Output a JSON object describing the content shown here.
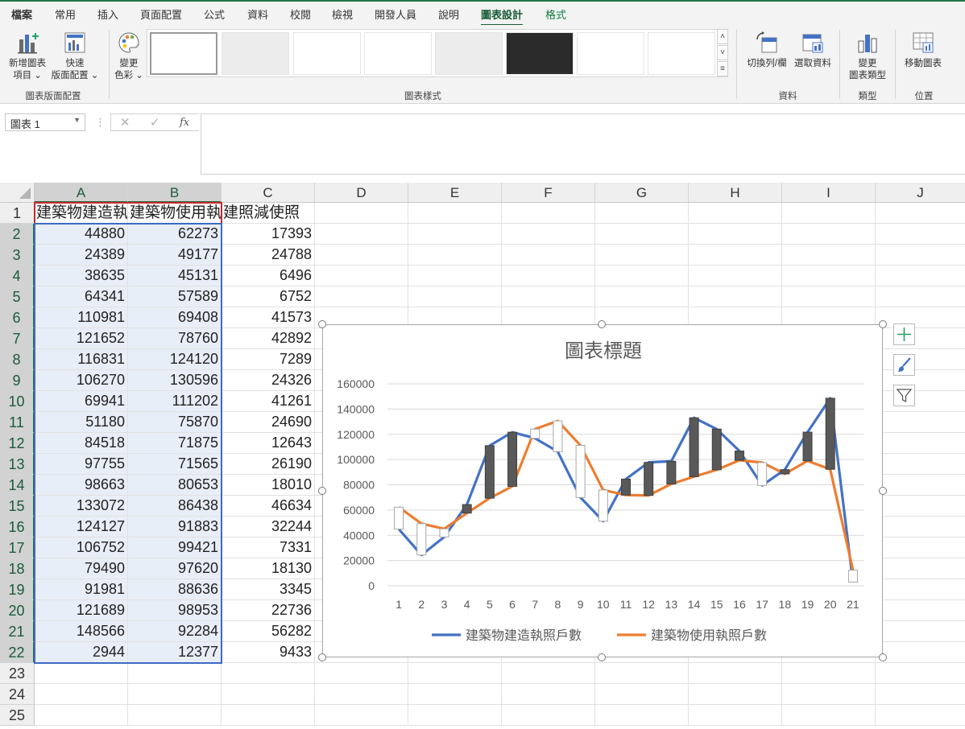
{
  "ribbon_tabs": [
    "檔案",
    "常用",
    "插入",
    "頁面配置",
    "公式",
    "資料",
    "校閱",
    "檢視",
    "開發人員",
    "說明",
    "圖表設計",
    "格式"
  ],
  "active_tab": "圖表設計",
  "ribbon": {
    "add_element": [
      "新增圖表",
      "項目"
    ],
    "quick_layout": [
      "快速",
      "版面配置"
    ],
    "change_colors": [
      "變更",
      "色彩"
    ],
    "group_layouts": "圖表版面配置",
    "group_styles": "圖表樣式",
    "switch_row_col": "切換列/欄",
    "select_data": "選取資料",
    "group_data": "資料",
    "change_type": [
      "變更",
      "圖表類型"
    ],
    "group_type": "類型",
    "move_chart": "移動圖表",
    "group_location": "位置"
  },
  "formula_bar": {
    "name_box": "圖表 1",
    "formula": ""
  },
  "columns": [
    "A",
    "B",
    "C",
    "D",
    "E",
    "F",
    "G",
    "H",
    "I",
    "J"
  ],
  "rows": [
    "1",
    "2",
    "3",
    "4",
    "5",
    "6",
    "7",
    "8",
    "9",
    "10",
    "11",
    "12",
    "13",
    "14",
    "15",
    "16",
    "17",
    "18",
    "19",
    "20",
    "21",
    "22",
    "23",
    "24",
    "25"
  ],
  "headers": {
    "A": "建築物建造執照戶數",
    "B": "建築物使用執照戶數",
    "C": "建照減使照"
  },
  "table": {
    "A": [
      44880,
      24389,
      38635,
      64341,
      110981,
      121652,
      116831,
      106270,
      69941,
      51180,
      84518,
      97755,
      98663,
      133072,
      124127,
      106752,
      79490,
      91981,
      121689,
      148566,
      2944
    ],
    "B": [
      62273,
      49177,
      45131,
      57589,
      69408,
      78760,
      124120,
      130596,
      111202,
      75870,
      71875,
      71565,
      80653,
      86438,
      91883,
      99421,
      97620,
      88636,
      98953,
      92284,
      12377
    ],
    "C": [
      17393,
      24788,
      6496,
      6752,
      41573,
      42892,
      7289,
      24326,
      41261,
      24690,
      12643,
      26190,
      18010,
      46634,
      32244,
      7331,
      18130,
      3345,
      22736,
      56282,
      9433
    ]
  },
  "colors": {
    "accent": "#217346",
    "series1": "#4472c4",
    "series2": "#ed7d31",
    "updown_down": "#595959",
    "updown_up": "#ffffff"
  },
  "chart_data": {
    "type": "line",
    "title": "圖表標題",
    "categories": [
      "1",
      "2",
      "3",
      "4",
      "5",
      "6",
      "7",
      "8",
      "9",
      "10",
      "11",
      "12",
      "13",
      "14",
      "15",
      "16",
      "17",
      "18",
      "19",
      "20",
      "21"
    ],
    "series": [
      {
        "name": "建築物建造執照戶數",
        "values": [
          44880,
          24389,
          38635,
          64341,
          110981,
          121652,
          116831,
          106270,
          69941,
          51180,
          84518,
          97755,
          98663,
          133072,
          124127,
          106752,
          79490,
          91981,
          121689,
          148566,
          2944
        ]
      },
      {
        "name": "建築物使用執照戶數",
        "values": [
          62273,
          49177,
          45131,
          57589,
          69408,
          78760,
          124120,
          130596,
          111202,
          75870,
          71875,
          71565,
          80653,
          86438,
          91883,
          99421,
          97620,
          88636,
          98953,
          92284,
          12377
        ]
      }
    ],
    "up_down_bars": true,
    "ylim": [
      0,
      160000
    ],
    "yticks": [
      "0",
      "20000",
      "40000",
      "60000",
      "80000",
      "100000",
      "120000",
      "140000",
      "160000"
    ],
    "grid": true,
    "legend": "bottom"
  }
}
